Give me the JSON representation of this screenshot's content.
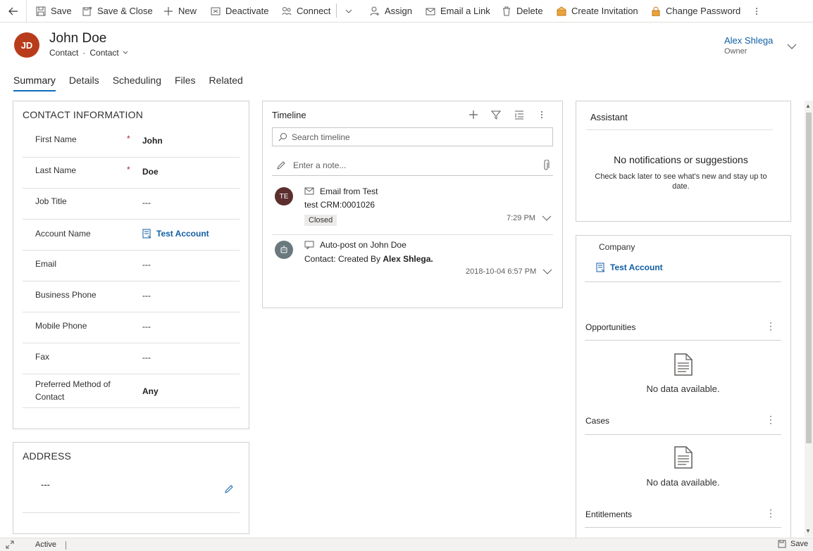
{
  "toolbar": {
    "items": [
      {
        "label": "Save",
        "icon": "save-icon"
      },
      {
        "label": "Save & Close",
        "icon": "save-close-icon"
      },
      {
        "label": "New",
        "icon": "plus-icon"
      },
      {
        "label": "Deactivate",
        "icon": "deactivate-icon"
      },
      {
        "label": "Connect",
        "icon": "connect-icon"
      },
      {
        "label": "Assign",
        "icon": "assign-icon"
      },
      {
        "label": "Email a Link",
        "icon": "email-icon"
      },
      {
        "label": "Delete",
        "icon": "trash-icon"
      },
      {
        "label": "Create Invitation",
        "icon": "invitation-icon"
      },
      {
        "label": "Change Password",
        "icon": "lock-icon"
      }
    ]
  },
  "header": {
    "initials": "JD",
    "avatar_color": "#b83c1b",
    "name": "John Doe",
    "entity": "Contact",
    "form": "Contact",
    "owner_name": "Alex Shlega",
    "owner_role": "Owner"
  },
  "tabs": [
    "Summary",
    "Details",
    "Scheduling",
    "Files",
    "Related"
  ],
  "contact_info": {
    "title": "CONTACT INFORMATION",
    "fields": [
      {
        "label": "First Name",
        "value": "John"
      },
      {
        "label": "Last Name",
        "value": "Doe"
      },
      {
        "label": "Job Title",
        "value": "---"
      },
      {
        "label": "Account Name",
        "value": "Test Account"
      },
      {
        "label": "Email",
        "value": "---"
      },
      {
        "label": "Business Phone",
        "value": "---"
      },
      {
        "label": "Mobile Phone",
        "value": "---"
      },
      {
        "label": "Fax",
        "value": "---"
      },
      {
        "label": "Preferred Method of Contact",
        "value": "Any"
      }
    ],
    "required_marker": "*"
  },
  "address": {
    "title": "ADDRESS",
    "value": "---"
  },
  "timeline": {
    "title": "Timeline",
    "search_placeholder": "Search timeline",
    "note_placeholder": "Enter a note...",
    "items": [
      {
        "initials": "TE",
        "avatar_color": "#5c2e2e",
        "title": "Email from Test",
        "body": "test CRM:0001026",
        "badge": "Closed",
        "time": "7:29 PM"
      },
      {
        "initials": "",
        "avatar_color": "#69797e",
        "title": "Auto-post on John Doe",
        "body_prefix": "Contact: Created By ",
        "body_bold": "Alex Shlega.",
        "time": "2018-10-04 6:57 PM"
      }
    ]
  },
  "assistant": {
    "title": "Assistant",
    "empty_title": "No notifications or suggestions",
    "empty_sub": "Check back later to see what's new and stay up to date."
  },
  "related": {
    "company_label": "Company",
    "company_value": "Test Account",
    "sections": [
      {
        "title": "Opportunities",
        "empty": "No data available."
      },
      {
        "title": "Cases",
        "empty": "No data available."
      },
      {
        "title": "Entitlements"
      }
    ]
  },
  "statusbar": {
    "status": "Active",
    "save_label": "Save"
  }
}
